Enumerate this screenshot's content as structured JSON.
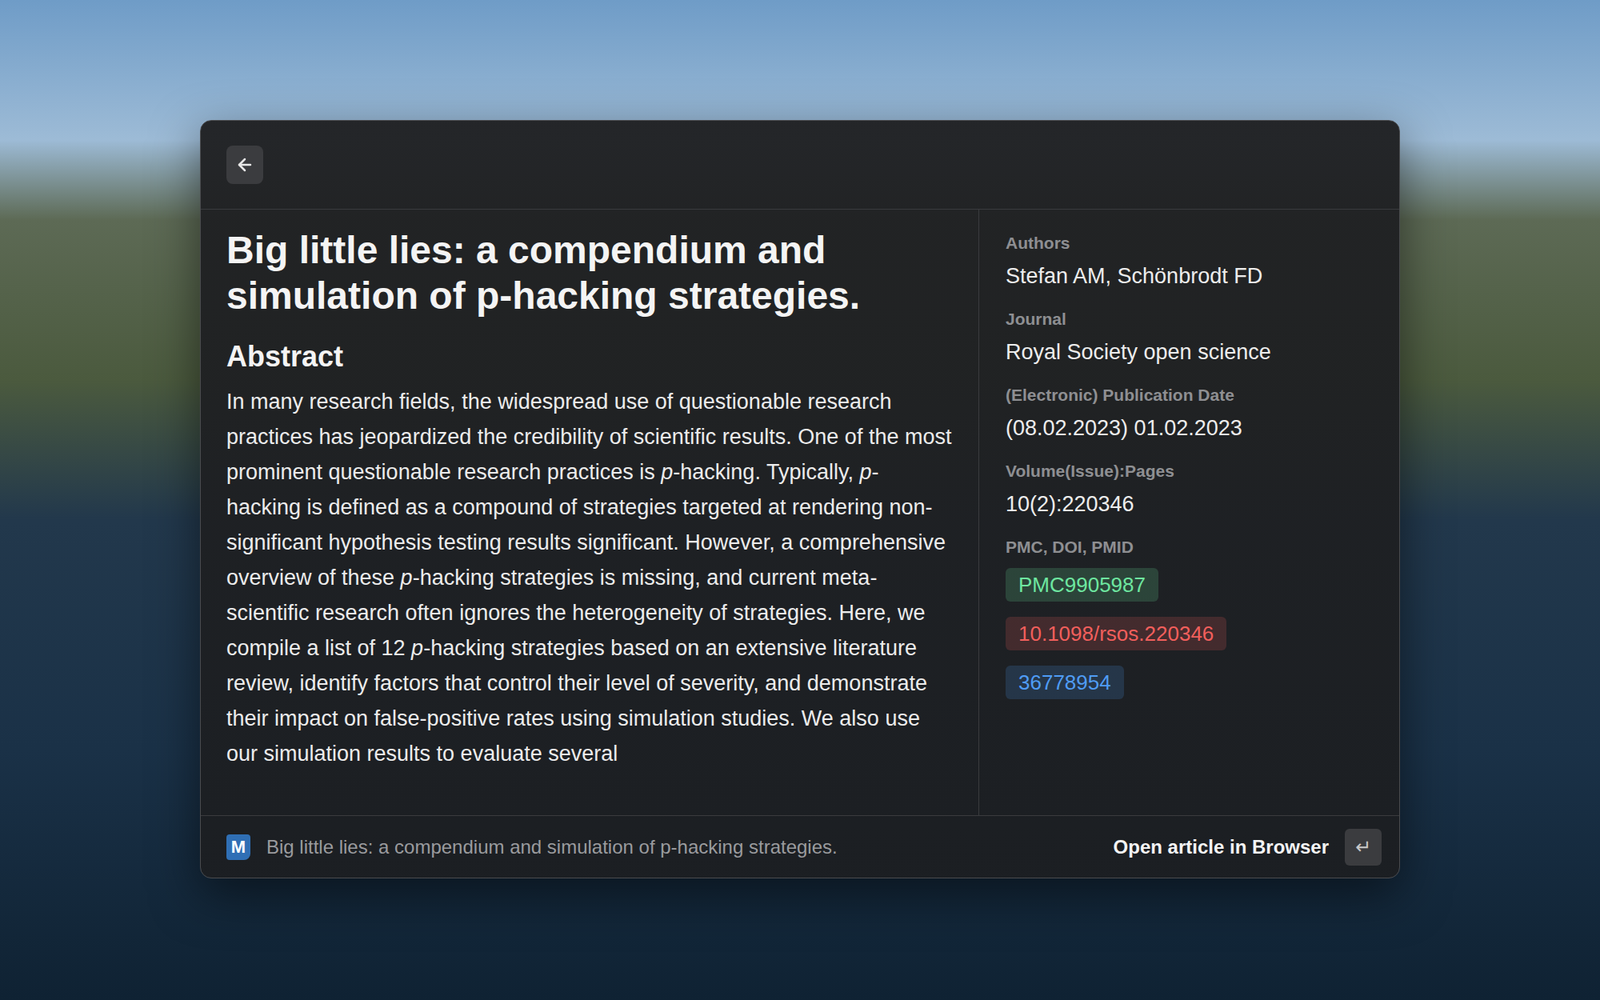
{
  "article": {
    "title": "Big little lies: a compendium and simulation of p-hacking strategies.",
    "abstract_heading": "Abstract",
    "abstract": [
      {
        "text": "In many research fields, the widespread use of questionable research practices has jeopardized the credibility of scientific results. One of the most prominent questionable research practices is ",
        "italic": false
      },
      {
        "text": "p",
        "italic": true
      },
      {
        "text": "-hacking. Typically, ",
        "italic": false
      },
      {
        "text": "p",
        "italic": true
      },
      {
        "text": "-hacking is defined as a compound of strategies targeted at rendering non-significant hypothesis testing results significant. However, a comprehensive overview of these ",
        "italic": false
      },
      {
        "text": "p",
        "italic": true
      },
      {
        "text": "-hacking strategies is missing, and current meta-scientific research often ignores the heterogeneity of strategies. Here, we compile a list of 12 ",
        "italic": false
      },
      {
        "text": "p",
        "italic": true
      },
      {
        "text": "-hacking strategies based on an extensive literature review, identify factors that control their level of severity, and demonstrate their impact on false-positive rates using simulation studies. We also use our simulation results to evaluate several",
        "italic": false
      }
    ]
  },
  "fields": [
    {
      "label": "Authors",
      "value": "Stefan AM, Schönbrodt FD"
    },
    {
      "label": "Journal",
      "value": "Royal Society open science"
    },
    {
      "label": "(Electronic) Publication Date",
      "value": "(08.02.2023) 01.02.2023"
    },
    {
      "label": "Volume(Issue):Pages",
      "value": "10(2):220346"
    }
  ],
  "identifiers": {
    "label": "PMC, DOI, PMID",
    "items": [
      {
        "text": "PMC9905987",
        "color": "#6ee7a0"
      },
      {
        "text": "10.1098/rsos.220346",
        "color": "#f25f5c"
      },
      {
        "text": "36778954",
        "color": "#4f9cf5"
      }
    ]
  },
  "footer": {
    "logo": "M",
    "title": "Big little lies: a compendium and simulation of p-hacking strategies.",
    "action": "Open article in Browser",
    "key": "↵"
  }
}
